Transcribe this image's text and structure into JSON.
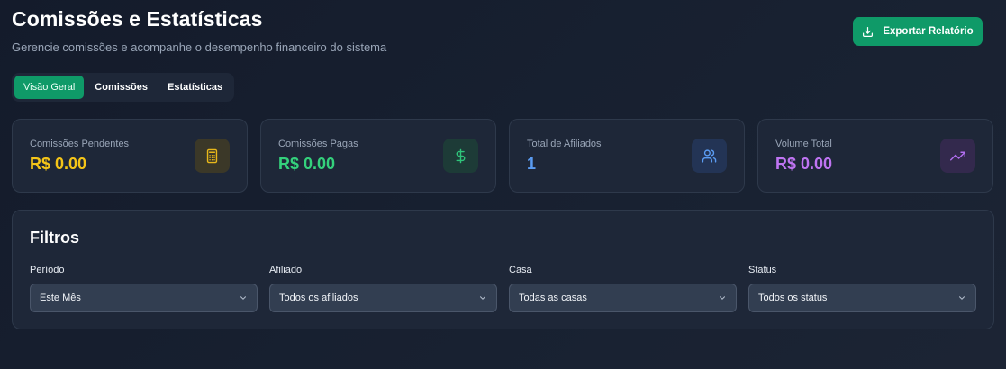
{
  "header": {
    "title": "Comissões e Estatísticas",
    "subtitle": "Gerencie comissões e acompanhe o desempenho financeiro do sistema",
    "export_label": "Exportar Relatório",
    "export_icon": "download-icon"
  },
  "tabs": [
    {
      "label": "Visão Geral",
      "active": true
    },
    {
      "label": "Comissões",
      "active": false
    },
    {
      "label": "Estatísticas",
      "active": false
    }
  ],
  "stats": [
    {
      "label": "Comissões Pendentes",
      "value": "R$ 0.00",
      "color": "#f5c518",
      "icon": "calculator-icon",
      "icon_bg": "#3b3828",
      "icon_color": "#e9b81a"
    },
    {
      "label": "Comissões Pagas",
      "value": "R$ 0.00",
      "color": "#34d17c",
      "icon": "dollar-icon",
      "icon_bg": "#1d3b37",
      "icon_color": "#2fc47a"
    },
    {
      "label": "Total de Afiliados",
      "value": "1",
      "color": "#5b9cf2",
      "icon": "users-icon",
      "icon_bg": "#233455",
      "icon_color": "#5b9cf2"
    },
    {
      "label": "Volume Total",
      "value": "R$ 0.00",
      "color": "#bf74f2",
      "icon": "trending-up-icon",
      "icon_bg": "#33294d",
      "icon_color": "#b26ef0"
    }
  ],
  "filters": {
    "title": "Filtros",
    "fields": [
      {
        "label": "Período",
        "value": "Este Mês"
      },
      {
        "label": "Afiliado",
        "value": "Todos os afiliados"
      },
      {
        "label": "Casa",
        "value": "Todas as casas"
      },
      {
        "label": "Status",
        "value": "Todos os status"
      }
    ]
  },
  "colors": {
    "accent": "#0f9a68",
    "card_bg": "#1e2738",
    "page_bg": "#161d2c"
  }
}
